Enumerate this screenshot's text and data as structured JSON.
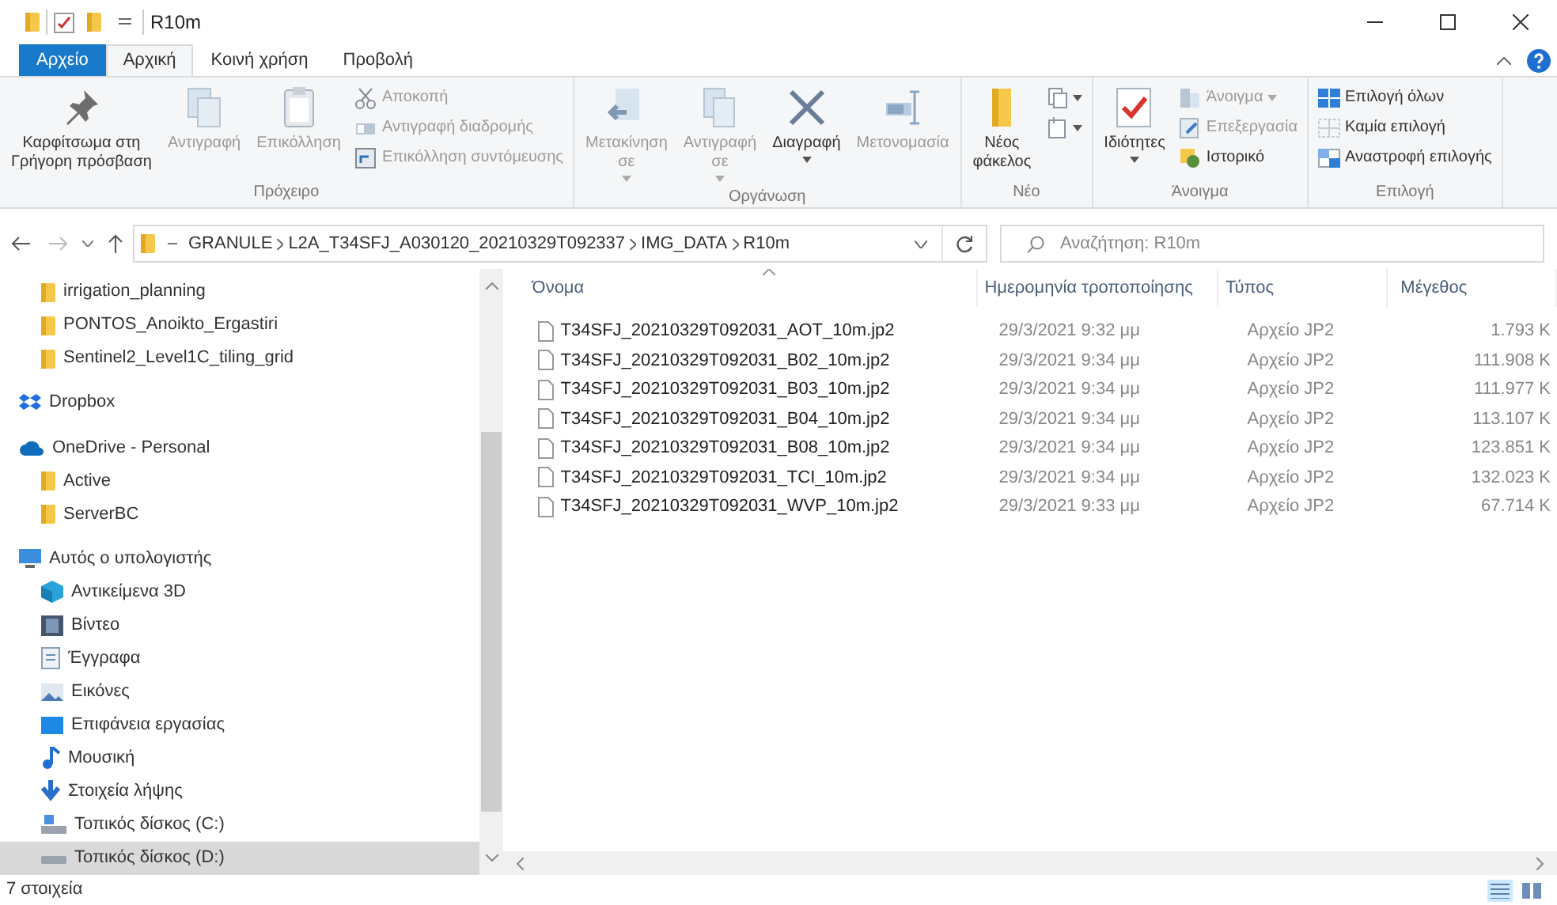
{
  "window": {
    "title": "R10m"
  },
  "tabs": [
    {
      "label": "Αρχείο",
      "kind": "file",
      "selected": false
    },
    {
      "label": "Αρχική",
      "kind": "tab",
      "selected": true
    },
    {
      "label": "Κοινή χρήση",
      "kind": "tab",
      "selected": false
    },
    {
      "label": "Προβολή",
      "kind": "tab",
      "selected": false
    }
  ],
  "ribbon": {
    "groups": [
      {
        "label": "Πρόχειρο",
        "items": [
          {
            "kind": "large",
            "lines": [
              "Καρφίτσωμα στη",
              "Γρήγορη πρόσβαση"
            ],
            "disabled": false,
            "dropdown": false
          },
          {
            "kind": "large",
            "lines": [
              "Αντιγραφή"
            ],
            "disabled": true,
            "dropdown": false
          },
          {
            "kind": "large",
            "lines": [
              "Επικόλληση"
            ],
            "disabled": true,
            "dropdown": false
          },
          {
            "kind": "stack",
            "items": [
              {
                "label": "Αποκοπή",
                "disabled": true,
                "dropdown": false
              },
              {
                "label": "Αντιγραφή διαδρομής",
                "disabled": true,
                "dropdown": false
              },
              {
                "label": "Επικόλληση συντόμευσης",
                "disabled": true,
                "dropdown": false
              }
            ]
          }
        ]
      },
      {
        "label": "Οργάνωση",
        "items": [
          {
            "kind": "large",
            "lines": [
              "Μετακίνηση",
              "σε"
            ],
            "disabled": true,
            "dropdown": true
          },
          {
            "kind": "large",
            "lines": [
              "Αντιγραφή",
              "σε"
            ],
            "disabled": true,
            "dropdown": true
          },
          {
            "kind": "large",
            "lines": [
              "Διαγραφή"
            ],
            "disabled": false,
            "dropdown": true
          },
          {
            "kind": "large",
            "lines": [
              "Μετονομασία"
            ],
            "disabled": true,
            "dropdown": false
          }
        ]
      },
      {
        "label": "Νέο",
        "items": [
          {
            "kind": "large",
            "lines": [
              "Νέος",
              "φάκελος"
            ],
            "disabled": false,
            "dropdown": false
          },
          {
            "kind": "stack",
            "items": [
              {
                "disabled": false,
                "dropdown": true
              },
              {
                "disabled": false,
                "dropdown": true
              }
            ]
          }
        ]
      },
      {
        "label": "Άνοιγμα",
        "items": [
          {
            "kind": "large",
            "lines": [
              "Ιδιότητες"
            ],
            "disabled": false,
            "dropdown": true
          },
          {
            "kind": "stack",
            "items": [
              {
                "label": "Άνοιγμα",
                "disabled": true,
                "dropdown": true
              },
              {
                "label": "Επεξεργασία",
                "disabled": true,
                "dropdown": false
              },
              {
                "label": "Ιστορικό",
                "disabled": false,
                "dropdown": false
              }
            ]
          }
        ]
      },
      {
        "label": "Επιλογή",
        "items": [
          {
            "kind": "stack",
            "items": [
              {
                "label": "Επιλογή όλων",
                "disabled": false,
                "dropdown": false
              },
              {
                "label": "Καμία επιλογή",
                "disabled": false,
                "dropdown": false
              },
              {
                "label": "Αναστροφή επιλογής",
                "disabled": false,
                "dropdown": false
              }
            ]
          }
        ]
      }
    ]
  },
  "address": {
    "path": [
      "GRANULE",
      "L2A_T34SFJ_A030120_20210329T092337",
      "IMG_DATA",
      "R10m"
    ]
  },
  "search": {
    "placeholder": "Αναζήτηση: R10m"
  },
  "navigation": {
    "items": [
      {
        "children": [
          {
            "kind": "folder",
            "label": "irrigation_planning",
            "selected": false
          },
          {
            "kind": "folder",
            "label": "PONTOS_Anoikto_Ergastiri",
            "selected": false
          },
          {
            "kind": "folder",
            "label": "Sentinel2_Level1C_tiling_grid",
            "selected": false
          }
        ]
      },
      {
        "kind": "dropbox",
        "label": "Dropbox",
        "selected": false
      },
      {
        "kind": "onedrive",
        "label": "OneDrive - Personal",
        "selected": false,
        "children": [
          {
            "kind": "folder",
            "label": "Active",
            "selected": false
          },
          {
            "kind": "folder",
            "label": "ServerBC",
            "selected": false
          }
        ]
      },
      {
        "kind": "pc",
        "label": "Αυτός ο υπολογιστής",
        "selected": false,
        "children": [
          {
            "kind": "objects3d",
            "label": "Αντικείμενα 3D",
            "selected": false
          },
          {
            "kind": "video",
            "label": "Βίντεο",
            "selected": false
          },
          {
            "kind": "documents",
            "label": "Έγγραφα",
            "selected": false
          },
          {
            "kind": "pictures",
            "label": "Εικόνες",
            "selected": false
          },
          {
            "kind": "desktop",
            "label": "Επιφάνεια εργασίας",
            "selected": false
          },
          {
            "kind": "music",
            "label": "Μουσική",
            "selected": false
          },
          {
            "kind": "downloads",
            "label": "Στοιχεία λήψης",
            "selected": false
          },
          {
            "kind": "drive_c",
            "label": "Τοπικός δίσκος (C:)",
            "selected": false
          },
          {
            "kind": "drive",
            "label": "Τοπικός δίσκος (D:)",
            "selected": true
          }
        ]
      }
    ]
  },
  "file_list": {
    "columns": [
      "Όνομα",
      "Ημερομηνία τροποποίησης",
      "Τύπος",
      "Μέγεθος"
    ],
    "rows": [
      {
        "name": "T34SFJ_20210329T092031_AOT_10m.jp2",
        "date": "29/3/2021 9:32 μμ",
        "type": "Αρχείο JP2",
        "size": "1.793 K",
        "selected": false
      },
      {
        "name": "T34SFJ_20210329T092031_B02_10m.jp2",
        "date": "29/3/2021 9:34 μμ",
        "type": "Αρχείο JP2",
        "size": "111.908 K",
        "selected": false
      },
      {
        "name": "T34SFJ_20210329T092031_B03_10m.jp2",
        "date": "29/3/2021 9:34 μμ",
        "type": "Αρχείο JP2",
        "size": "111.977 K",
        "selected": false
      },
      {
        "name": "T34SFJ_20210329T092031_B04_10m.jp2",
        "date": "29/3/2021 9:34 μμ",
        "type": "Αρχείο JP2",
        "size": "113.107 K",
        "selected": false
      },
      {
        "name": "T34SFJ_20210329T092031_B08_10m.jp2",
        "date": "29/3/2021 9:34 μμ",
        "type": "Αρχείο JP2",
        "size": "123.851 K",
        "selected": false
      },
      {
        "name": "T34SFJ_20210329T092031_TCI_10m.jp2",
        "date": "29/3/2021 9:34 μμ",
        "type": "Αρχείο JP2",
        "size": "132.023 K",
        "selected": false
      },
      {
        "name": "T34SFJ_20210329T092031_WVP_10m.jp2",
        "date": "29/3/2021 9:33 μμ",
        "type": "Αρχείο JP2",
        "size": "67.714 K",
        "selected": false
      }
    ]
  },
  "status_bar": {
    "text": "7 στοιχεία"
  }
}
